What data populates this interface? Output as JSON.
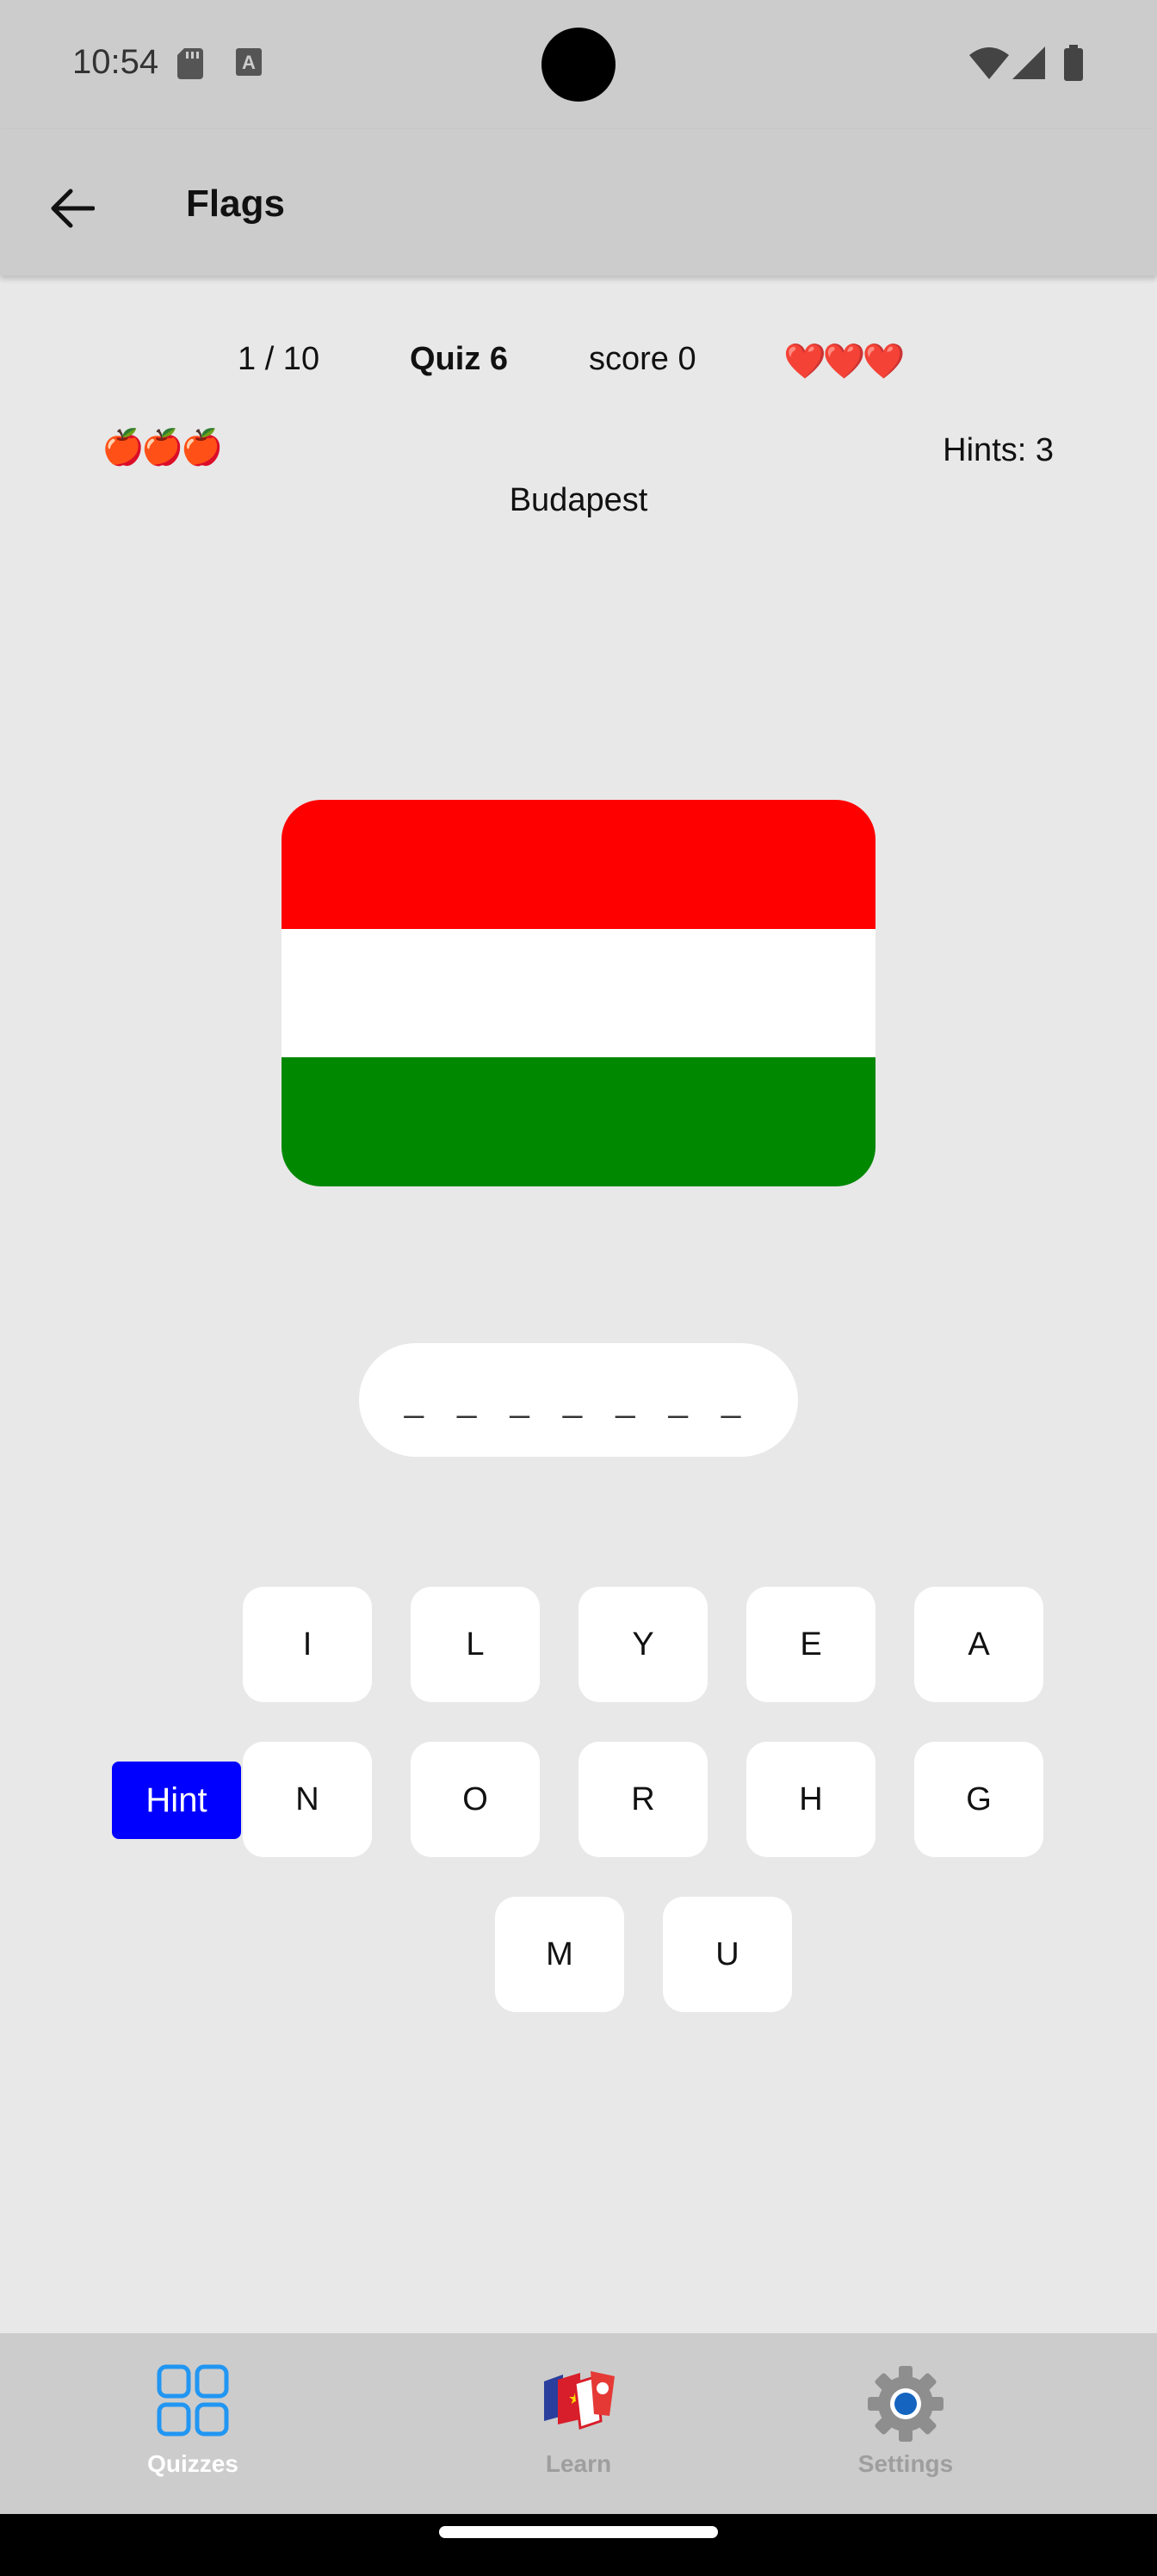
{
  "status_bar": {
    "time": "10:54"
  },
  "app_bar": {
    "title": "Flags"
  },
  "quiz": {
    "counter": "1 / 10",
    "name": "Quiz 6",
    "score": "score 0",
    "hearts": "❤️❤️❤️",
    "apples": "🍎🍎🍎",
    "hints": "Hints: 3",
    "capital": "Budapest",
    "flag_colors": [
      "#ff0000",
      "#ffffff",
      "#008800"
    ],
    "answer_blanks": "_ _ _ _ _ _ _"
  },
  "keyboard": {
    "hint_label": "Hint",
    "hint_color": "#0000ff",
    "row1": [
      "I",
      "L",
      "Y",
      "E",
      "A"
    ],
    "row2": [
      "N",
      "O",
      "R",
      "H",
      "G"
    ],
    "row3": [
      "M",
      "U"
    ]
  },
  "bottom_nav": {
    "items": [
      {
        "label": "Quizzes",
        "icon": "grid-icon",
        "active": true
      },
      {
        "label": "Learn",
        "icon": "flags-icon",
        "active": false
      },
      {
        "label": "Settings",
        "icon": "gear-icon",
        "active": false
      }
    ],
    "active_color": "#2196f3",
    "inactive_color": "#9e9e9e"
  }
}
